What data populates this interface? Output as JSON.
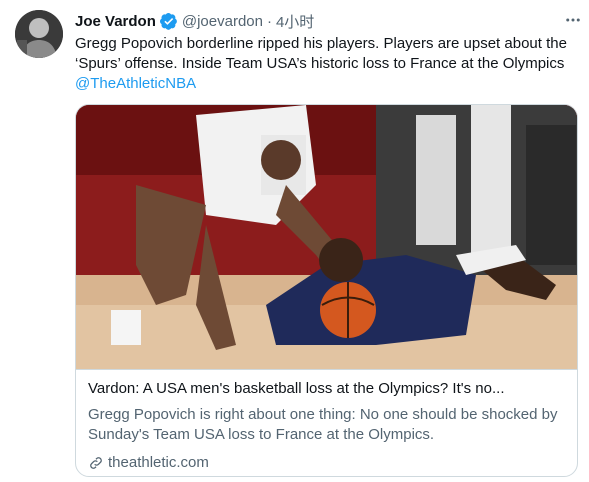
{
  "tweet": {
    "author_name": "Joe Vardon",
    "handle": "@joevardon",
    "separator": "·",
    "time": "4小时",
    "text_line1": "Gregg Popovich borderline ripped his players. Players are upset about the",
    "text_line2": "‘Spurs’ offense. Inside Team USA’s historic loss to France at the Olympics",
    "mention": "@TheAthleticNBA"
  },
  "card": {
    "title": "Vardon: A USA men's basketball loss at the Olympics? It's no...",
    "description": "Gregg Popovich is right about one thing: No one should be shocked by Sunday's Team USA loss to France at the Olympics.",
    "domain": "theathletic.com"
  },
  "colors": {
    "link": "#1d9bf0",
    "secondary_text": "#536471",
    "border": "#cfd9de"
  },
  "icons": {
    "verified": "verified-badge-icon",
    "more": "more-options-icon",
    "link": "link-icon"
  }
}
